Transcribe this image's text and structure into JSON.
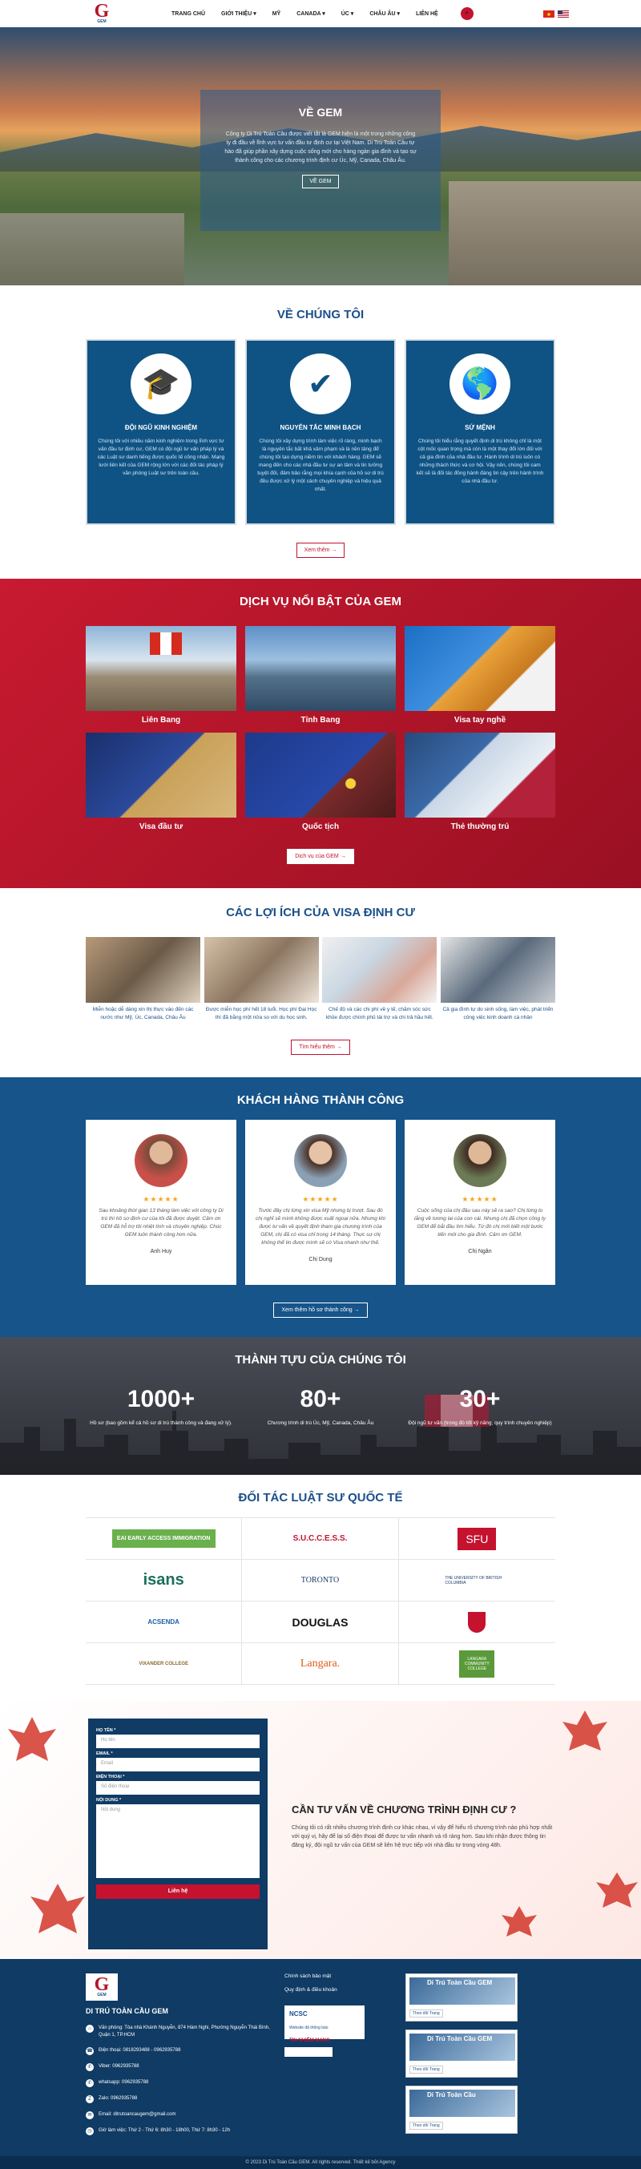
{
  "header": {
    "logo_letter": "G",
    "logo_text": "GEM",
    "nav": [
      "TRANG CHỦ",
      "GIỚI THIỆU ▾",
      "MỸ",
      "CANADA ▾",
      "ÚC ▾",
      "CHÂU ÂU ▾",
      "LIÊN HỆ"
    ]
  },
  "hero": {
    "title": "VỀ GEM",
    "text": "Công ty Di Trú Toàn Cầu được viết tắt là GEM hiện là một trong những công ty đi đầu về lĩnh vực tư vấn đầu tư định cư tại Việt Nam. Di Trú Toàn Cầu tự hào đã giúp phần xây dựng cuộc sống mới cho hàng ngàn gia đình và tạo sự thành công cho các chương trình định cư Úc, Mỹ, Canada, Châu Âu.",
    "button": "VỀ GEM"
  },
  "about": {
    "title": "VỀ CHÚNG TÔI",
    "cards": [
      {
        "icon": "graduation-cap-icon",
        "glyph": "🎓",
        "title": "ĐỘI NGŨ KINH NGHIỆM",
        "text": "Chúng tôi với nhiều năm kinh nghiệm trong lĩnh vực tư vấn đầu tư định cư, GEM có đội ngũ tư vấn pháp lý và các Luật sư danh tiếng được quốc tế công nhận. Mạng lưới liên kết của GEM rộng lớn với các đối tác pháp lý văn phòng Luật sư trên toàn cầu."
      },
      {
        "icon": "checkmark-person-icon",
        "glyph": "✔",
        "title": "NGUYÊN TẮC MINH BẠCH",
        "text": "Chúng tôi xây dựng trình làm việc rõ ràng, minh bạch là nguyên tắc bất khả xâm phạm và là nền tảng để chúng tôi tạo dựng niềm tin với khách hàng. GEM sẽ mang đến cho các nhà đầu tư sự an tâm và tin tưởng tuyệt đối, đảm bảo rằng mọi khía cạnh của hồ sơ di trú đều được xử lý một cách chuyên nghiệp và hiệu quả nhất."
      },
      {
        "icon": "globe-icon",
        "glyph": "🌎",
        "title": "SỨ MỆNH",
        "text": "Chúng tôi hiểu rằng quyết định di trú không chỉ là một cột mốc quan trọng mà còn là một thay đổi lớn đối với cả gia đình của nhà đầu tư. Hành trình di trú luôn có những thách thức và cơ hội. Vậy nên, chúng tôi cam kết sẽ là đối tác đồng hành đáng tin cậy trên hành trình của nhà đầu tư."
      }
    ],
    "button": "Xem thêm"
  },
  "services": {
    "title": "DỊCH VỤ NỔI BẬT CỦA GEM",
    "items": [
      {
        "label": "Liên Bang"
      },
      {
        "label": "Tỉnh Bang"
      },
      {
        "label": "Visa tay nghề"
      },
      {
        "label": "Visa đầu tư"
      },
      {
        "label": "Quốc tịch"
      },
      {
        "label": "Thẻ thường trú"
      }
    ],
    "button": "Dịch vụ của GEM"
  },
  "benefits": {
    "title": "CÁC LỢI ÍCH CỦA VISA ĐỊNH CƯ",
    "items": [
      "Miễn hoặc dễ dàng xin thị thực vào đến các nước như Mỹ, Úc, Canada, Châu Âu",
      "Được miễn học phí hết 18 tuổi. Học phí Đại Học thì đã bằng một nửa so với du học sinh.",
      "Chế độ và các chi phí về y tế, chăm sóc sức khỏe được chính phủ tài trợ và chi trả hầu hết.",
      "Cả gia đình tự do sinh sống, làm việc, phát triển công việc kinh doanh cá nhân"
    ],
    "button": "Tìm hiểu thêm"
  },
  "customers": {
    "title": "KHÁCH HÀNG THÀNH CÔNG",
    "stars": "★★★★★",
    "items": [
      {
        "text": "Sau khoảng thời gian 13 tháng làm việc với công ty Di trú thì hồ sơ định cư của tôi đã được duyệt. Cảm ơn GEM đã hỗ trợ tôi nhiệt tình và chuyên nghiệp. Chúc GEM luôn thành công hơn nữa.",
        "name": "Anh Huy"
      },
      {
        "text": "Trước đây chị từng xin visa Mỹ nhưng bị trượt. Sau đó chị nghĩ sẽ mình không được xuất ngoại nữa. Nhưng khi được tư vấn về quyết định tham gia chương trình của GEM, chị đã có visa chỉ trong 14 tháng. Thực sự chị không thể tin được mình sẽ có Visa nhanh như thế.",
        "name": "Chị Dung"
      },
      {
        "text": "Cuộc sống của chị đầu sau này sẽ ra sao? Chị từng lo lắng về tương lai của con cái. Nhưng chị đã chọn công ty GEM để bắt đầu tìm hiểu. Từ đó chị mới biết một bước tiến mới cho gia đình. Cảm ơn GEM.",
        "name": "Chị Ngân"
      }
    ],
    "button": "Xem thêm hồ sơ thành công"
  },
  "achievements": {
    "title": "THÀNH TỰU CỦA CHÚNG TÔI",
    "items": [
      {
        "num": "1000+",
        "text": "Hồ sơ (bao gồm kể cả hồ sơ di trú thành công và đang xử lý)."
      },
      {
        "num": "80+",
        "text": "Chương trình di trú Úc, Mỹ, Canada, Châu Âu"
      },
      {
        "num": "30+",
        "text": "Đội ngũ tư vấn (trong đó tốt kỹ năng, quy trình chuyên nghiệp)"
      }
    ]
  },
  "partners": {
    "title": "ĐỐI TÁC LUẬT SƯ QUỐC TẾ",
    "logos": [
      "EAI EARLY ACCESS IMMIGRATION",
      "S.U.C.C.E.S.S.",
      "SFU",
      "isans",
      "TORONTO",
      "THE UNIVERSITY OF BRITISH COLUMBIA",
      "ACSENDA",
      "DOUGLAS",
      "",
      "VIXANDER COLLEGE",
      "Langara.",
      "LANGARA COMMUNITY COLLEGE"
    ]
  },
  "consult": {
    "form": {
      "name_label": "HỌ TÊN *",
      "name_ph": "Họ tên",
      "email_label": "EMAIL *",
      "email_ph": "Email",
      "phone_label": "ĐIỆN THOẠI *",
      "phone_ph": "Số điện thoại",
      "content_label": "NỘI DUNG *",
      "content_ph": "Nội dung",
      "submit": "Liên hệ"
    },
    "title": "CẦN TƯ VẤN VỀ CHƯƠNG TRÌNH ĐỊNH CƯ ?",
    "text": "Chúng tôi có rất nhiều chương trình định cư khác nhau, vì vậy để hiểu rõ chương trình nào phù hợp nhất với quý vị, hãy để lại số điện thoại để được tư vấn nhanh và rõ ràng hơn. Sau khi nhận được thông tin đăng ký, đội ngũ tư vấn của GEM sẽ liên hệ trực tiếp với nhà đầu tư trong vòng 48h."
  },
  "footer": {
    "company": "DI TRÚ TOÀN CẦU GEM",
    "lines": [
      {
        "icon": "location-icon",
        "glyph": "⌂",
        "text": "Văn phòng: Tòa nhà Khánh Nguyễn, 874 Hàm Nghi, Phường Nguyễn Thái Bình, Quận 1, TP.HCM"
      },
      {
        "icon": "phone-icon",
        "glyph": "☎",
        "text": "Điện thoại: 0818293488 - 0962935788"
      },
      {
        "icon": "viber-icon",
        "glyph": "✆",
        "text": "Viber: 0962935788"
      },
      {
        "icon": "whatsapp-icon",
        "glyph": "✆",
        "text": "whatsapp: 0962935788"
      },
      {
        "icon": "zalo-icon",
        "glyph": "Z",
        "text": "Zalo: 0962935788"
      },
      {
        "icon": "email-icon",
        "glyph": "✉",
        "text": "Email: ditrutoancaugem@gmail.com"
      },
      {
        "icon": "clock-icon",
        "glyph": "◷",
        "text": "Giờ làm việc: Thứ 2 - Thứ 6: 8h30 - 18h00, Thứ 7: 8h30 - 12h"
      }
    ],
    "links": [
      "Chính sách bảo mật",
      "Quy định & điều khoản"
    ],
    "cert_title": "Website đã thông báo",
    "cert_sub": "TIN NHIỆM MẠNG",
    "fb": [
      {
        "title": "Di Trú Toàn Cầu GEM",
        "like": "Theo dõi Trang"
      },
      {
        "title": "Di Trú Toàn Cầu GEM",
        "like": "Theo dõi Trang"
      },
      {
        "title": "Di Trú Toàn Cầu",
        "like": "Theo dõi Trang"
      }
    ],
    "copyright": "© 2023 Di Trú Toàn Cầu GEM. All rights reserved. Thiết kế bởi Agency"
  },
  "colors": {
    "brand_red": "#c4122f",
    "brand_blue": "#0f5384"
  }
}
